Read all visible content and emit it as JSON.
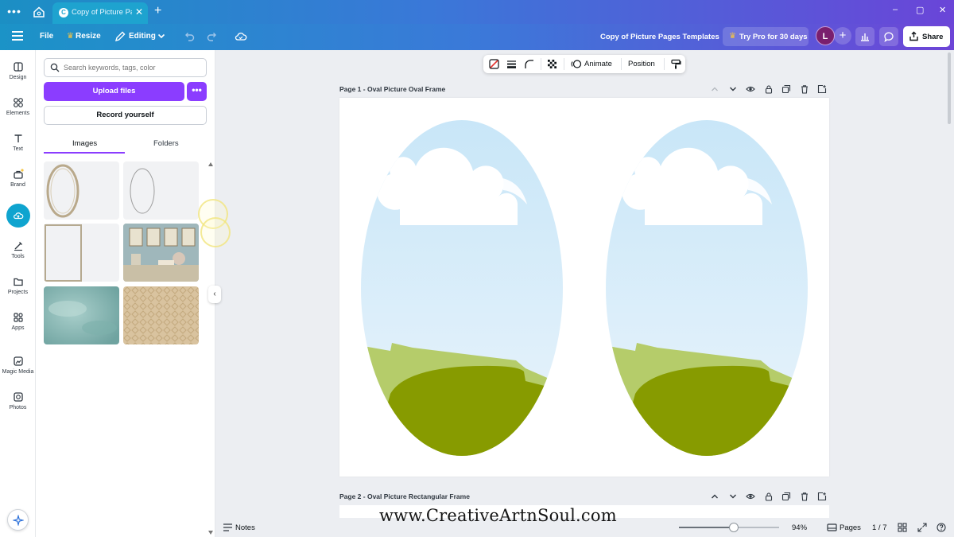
{
  "browser": {
    "tab_title": "Copy of Picture Pa...",
    "new_tab": "+",
    "minimize": "–",
    "maximize": "▢",
    "close": "✕"
  },
  "header": {
    "file_label": "File",
    "resize_label": "Resize",
    "editing_label": "Editing",
    "design_title": "Copy of Picture Pages Templates",
    "try_pro_label": "Try Pro for 30 days",
    "avatar_initial": "L",
    "share_label": "Share"
  },
  "rail": {
    "items": [
      {
        "label": "Design",
        "icon": "design-icon"
      },
      {
        "label": "Elements",
        "icon": "elements-icon"
      },
      {
        "label": "Text",
        "icon": "text-icon"
      },
      {
        "label": "Brand",
        "icon": "brand-icon"
      },
      {
        "label": "",
        "icon": "cloud-upload-icon"
      },
      {
        "label": "Tools",
        "icon": "tools-icon"
      },
      {
        "label": "Projects",
        "icon": "folder-icon"
      },
      {
        "label": "Apps",
        "icon": "apps-icon"
      },
      {
        "label": "Magic Media",
        "icon": "magic-media-icon"
      },
      {
        "label": "Photos",
        "icon": "photos-icon"
      }
    ]
  },
  "panel": {
    "search_placeholder": "Search keywords, tags, color",
    "upload_label": "Upload files",
    "more_label": "•••",
    "record_label": "Record yourself",
    "tabs": [
      {
        "label": "Images",
        "active": true
      },
      {
        "label": "Folders",
        "active": false
      }
    ],
    "thumbnails": [
      {
        "kind": "gold-oval-frame"
      },
      {
        "kind": "thin-oval-frame"
      },
      {
        "kind": "rectangle-frame"
      },
      {
        "kind": "vintage-shelf-photo"
      },
      {
        "kind": "teal-watercolor"
      },
      {
        "kind": "beige-damask"
      }
    ]
  },
  "toolbar": {
    "animate_label": "Animate",
    "position_label": "Position"
  },
  "canvas": {
    "page1_label": "Page 1 - Oval Picture Oval Frame",
    "page2_label": "Page 2 - Oval Picture Rectangular Frame",
    "watermark": "www.CreativeArtnSoul.com"
  },
  "footer": {
    "notes_label": "Notes",
    "zoom_value": "94%",
    "zoom_fraction": 0.55,
    "pages_label": "Pages",
    "page_count": "1 / 7"
  },
  "colors": {
    "accent": "#8b3dff",
    "sky": "#cfe8f8",
    "grass_light": "#b5cc6a",
    "grass_dark": "#879b00"
  }
}
